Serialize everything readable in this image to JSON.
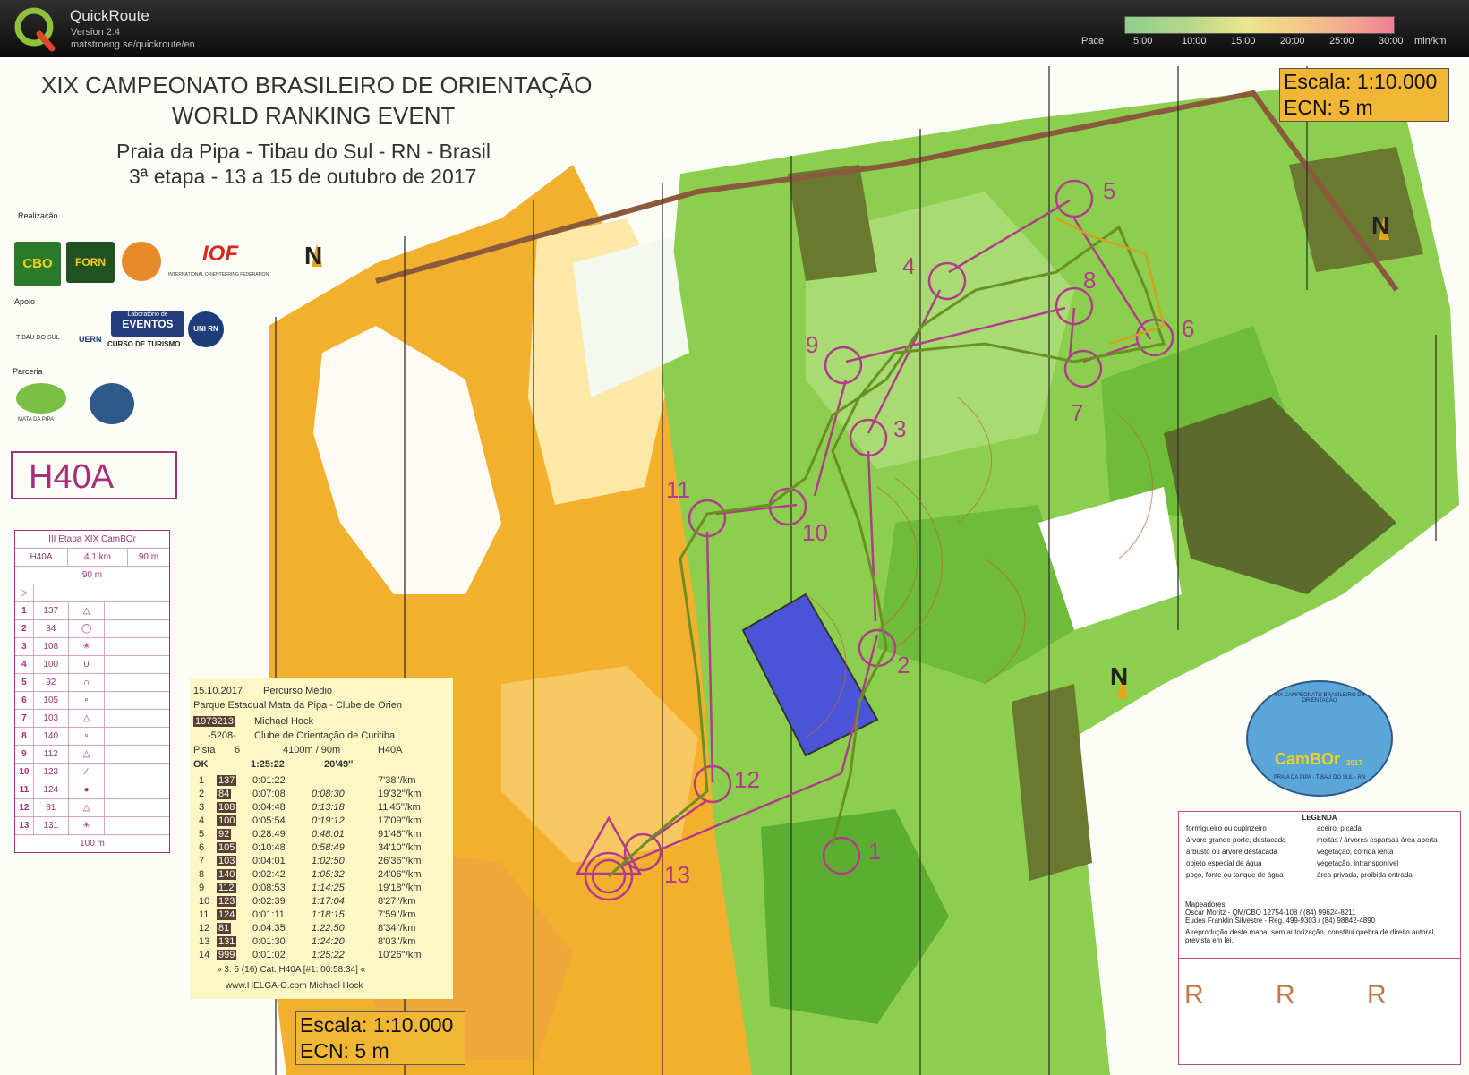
{
  "app": {
    "name": "QuickRoute",
    "version": "Version 2.4",
    "url": "matstroeng.se/quickroute/en"
  },
  "pace": {
    "label": "Pace",
    "ticks": [
      "5:00",
      "10:00",
      "15:00",
      "20:00",
      "25:00",
      "30:00"
    ],
    "unit": "min/km"
  },
  "map": {
    "title_line1": "XIX CAMPEONATO BRASILEIRO DE ORIENTAÇÃO",
    "title_line2": "WORLD RANKING EVENT",
    "subtitle_line1": "Praia da Pipa - Tibau do Sul - RN - Brasil",
    "subtitle_line2": "3ª etapa - 13 a 15 de outubro de 2017",
    "scale_top_1": "Escala: 1:10.000",
    "scale_top_2": "ECN: 5 m",
    "scale_bottom_1": "Escala: 1:10.000",
    "scale_bottom_2": "ECN: 5 m",
    "north_label": "N",
    "sponsors": {
      "realizacao": "Realização",
      "apoio": "Apoio",
      "parceria": "Parceria",
      "logo_cbo": "CBO",
      "logo_forn": "FORN",
      "logo_iof": "IOF",
      "logo_iof_sub": "INTERNATIONAL ORIENTEERING FEDERATION",
      "logo_tibau": "TIBAU DO SUL",
      "logo_uern": "UERN",
      "logo_eventos_1": "Laboratório de",
      "logo_eventos_2": "EVENTOS",
      "logo_turismo": "CURSO DE TURISMO",
      "logo_unirn": "UNI RN",
      "logo_mata": "MATA DA PIPA"
    },
    "class_name": "H40A",
    "control_numbers": [
      "1",
      "2",
      "3",
      "4",
      "5",
      "6",
      "7",
      "8",
      "9",
      "10",
      "11",
      "12",
      "13"
    ]
  },
  "control_description": {
    "header": "III Etapa XIX CamBOr",
    "class": "H40A",
    "length": "4,1 km",
    "climb": "90 m",
    "start_dist": "90 m",
    "finish_dist": "100 m",
    "rows": [
      {
        "n": "1",
        "code": "137"
      },
      {
        "n": "2",
        "code": "84"
      },
      {
        "n": "3",
        "code": "108"
      },
      {
        "n": "4",
        "code": "100"
      },
      {
        "n": "5",
        "code": "92"
      },
      {
        "n": "6",
        "code": "105"
      },
      {
        "n": "7",
        "code": "103"
      },
      {
        "n": "8",
        "code": "140"
      },
      {
        "n": "9",
        "code": "112"
      },
      {
        "n": "10",
        "code": "123"
      },
      {
        "n": "11",
        "code": "124"
      },
      {
        "n": "12",
        "code": "81"
      },
      {
        "n": "13",
        "code": "131"
      }
    ]
  },
  "splits": {
    "date": "15.10.2017",
    "course": "Percurso Médio",
    "venue": "Parque Estadual Mata da Pipa - Clube de Orien",
    "si": "1973213",
    "runner": "Michael Hock",
    "club_code": "-5208-",
    "club": "Clube de Orientação de Curitiba",
    "pista_label": "Pista",
    "pista": "6",
    "course_len": "4100m / 90m",
    "course_class": "H40A",
    "status": "OK",
    "total_time": "1:25:22",
    "pace_total": "20'49''",
    "rows": [
      {
        "n": "1",
        "code": "137",
        "leg": "0:01:22",
        "cum": "",
        "pace": "7'38''/km"
      },
      {
        "n": "2",
        "code": "84",
        "leg": "0:07:08",
        "cum": "0:08:30",
        "pace": "19'32''/km"
      },
      {
        "n": "3",
        "code": "108",
        "leg": "0:04:48",
        "cum": "0:13:18",
        "pace": "11'45''/km"
      },
      {
        "n": "4",
        "code": "100",
        "leg": "0:05:54",
        "cum": "0:19:12",
        "pace": "17'09''/km"
      },
      {
        "n": "5",
        "code": "92",
        "leg": "0:28:49",
        "cum": "0:48:01",
        "pace": "91'46''/km"
      },
      {
        "n": "6",
        "code": "105",
        "leg": "0:10:48",
        "cum": "0:58:49",
        "pace": "34'10''/km"
      },
      {
        "n": "7",
        "code": "103",
        "leg": "0:04:01",
        "cum": "1:02:50",
        "pace": "26'36''/km"
      },
      {
        "n": "8",
        "code": "140",
        "leg": "0:02:42",
        "cum": "1:05:32",
        "pace": "24'06''/km"
      },
      {
        "n": "9",
        "code": "112",
        "leg": "0:08:53",
        "cum": "1:14:25",
        "pace": "19'18''/km"
      },
      {
        "n": "10",
        "code": "123",
        "leg": "0:02:39",
        "cum": "1:17:04",
        "pace": "8'27''/km"
      },
      {
        "n": "11",
        "code": "124",
        "leg": "0:01:11",
        "cum": "1:18:15",
        "pace": "7'59''/km"
      },
      {
        "n": "12",
        "code": "81",
        "leg": "0:04:35",
        "cum": "1:22:50",
        "pace": "8'34''/km"
      },
      {
        "n": "13",
        "code": "131",
        "leg": "0:01:30",
        "cum": "1:24:20",
        "pace": "8'03''/km"
      },
      {
        "n": "14",
        "code": "999",
        "leg": "0:01:02",
        "cum": "1:25:22",
        "pace": "10'26''/km"
      }
    ],
    "footer1": "» 3. 5 (16) Cat. H40A [#1: 00:58:34] «",
    "footer2": "www.HELGA-O.com  Michael Hock"
  },
  "legend": {
    "title": "LEGENDA",
    "left": [
      "formigueiro ou cupinzeiro",
      "árvore grande porte, destacada",
      "arbusto ou árvore destacada",
      "objeto especial de água",
      "poço, fonte ou tanque de água"
    ],
    "right": [
      "aceiro, picada",
      "moitas / árvores esparsas área aberta",
      "vegetação, corrida lenta",
      "vegetação, intransponível",
      "área privada, proibida entrada"
    ],
    "mappers_title": "Mapeadores:",
    "mapper1": "Oscar Moritz - QM/CBO 12754-108 / (84) 99624-8211",
    "mapper2": "Eudes Franklin Silvestre - Reg. 499-9303 / (84) 98842-4890",
    "notice": "A reprodução deste mapa, sem autorização, constitui quebra de direito autoral, prevista em lei.",
    "r_letter": "R"
  },
  "event_logo": {
    "line1": "XIX CAMPEONATO BRASILEIRO DE ORIENTAÇÃO",
    "name": "CamBOr",
    "year": "2017",
    "place": "PRAIA DA PIPA - TIBAU DO SUL - RN"
  }
}
